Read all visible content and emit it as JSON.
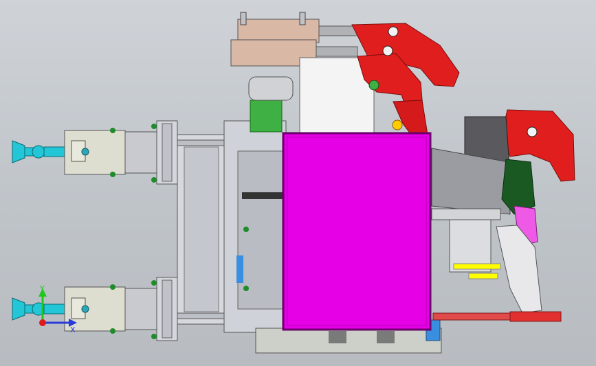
{
  "viewport": {
    "background_top": "#cfd3d8",
    "background_bottom": "#b8bcc1"
  },
  "triad": {
    "y_label": "Y",
    "x_label": "X",
    "y_color": "#1ec81e",
    "x_color": "#2a3cd8",
    "z_color": "#e01a1a"
  },
  "colors": {
    "magenta_block": "#e600e6",
    "clamp_red": "#e01e1e",
    "cylinder_tan": "#d9b8a6",
    "cyan_fitting": "#22c6d6",
    "housing_beige": "#ddddd0",
    "metal_grey": "#c8cad0",
    "fastener_green": "#1e8c2a",
    "panel_yellow": "#ffff00",
    "accent_blue": "#3a8ee0",
    "dark_cover": "#5a5a5e"
  },
  "icons": [
    "coordinate-triad-icon"
  ]
}
